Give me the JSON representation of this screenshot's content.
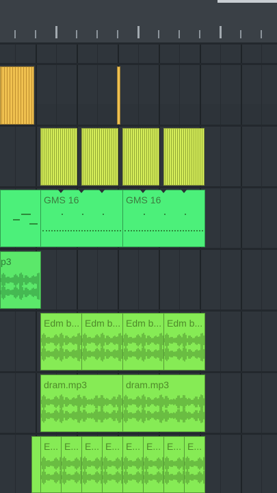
{
  "playlist": {
    "gms_clip_name": "GMS 16",
    "mp3_clip_name": "p3",
    "edm_clip_name": "Edm b...",
    "dram_clip_name": "dram.mp3",
    "e_clip_name": "E..."
  },
  "colors": {
    "background": "#2d3339",
    "yellow_pattern": "#f0c150",
    "lime_pattern": "#d6ee5a",
    "green_pattern": "#4cf07a",
    "audio_green": "#86eb55"
  }
}
